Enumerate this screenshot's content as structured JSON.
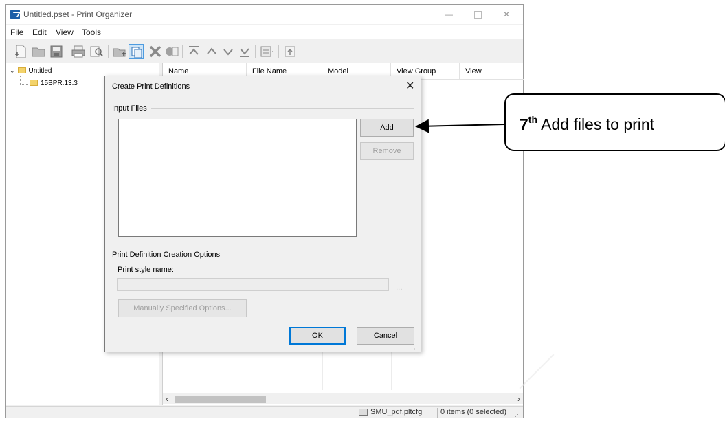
{
  "window": {
    "title": "Untitled.pset - Print Organizer",
    "menu": [
      "File",
      "Edit",
      "View",
      "Tools"
    ]
  },
  "tree": {
    "root": "Untitled",
    "child": "15BPR.13.3"
  },
  "list": {
    "columns": [
      "Name",
      "File Name",
      "Model",
      "View Group",
      "View"
    ]
  },
  "statusbar": {
    "config": "SMU_pdf.pltcfg",
    "items": "0 items (0 selected)"
  },
  "dialog": {
    "title": "Create Print Definitions",
    "close": "✕",
    "input_files_label": "Input Files",
    "add_label": "Add",
    "remove_label": "Remove",
    "options_label": "Print Definition Creation Options",
    "style_name_label": "Print style name:",
    "style_name_value": "",
    "browse_label": "...",
    "manual_options_label": "Manually Specified Options...",
    "ok_label": "OK",
    "cancel_label": "Cancel"
  },
  "callout": {
    "step_number": "7",
    "step_suffix": "th",
    "text": " Add files to print"
  },
  "colors": {
    "accent": "#0078d7",
    "folder": "#f3d36b"
  }
}
